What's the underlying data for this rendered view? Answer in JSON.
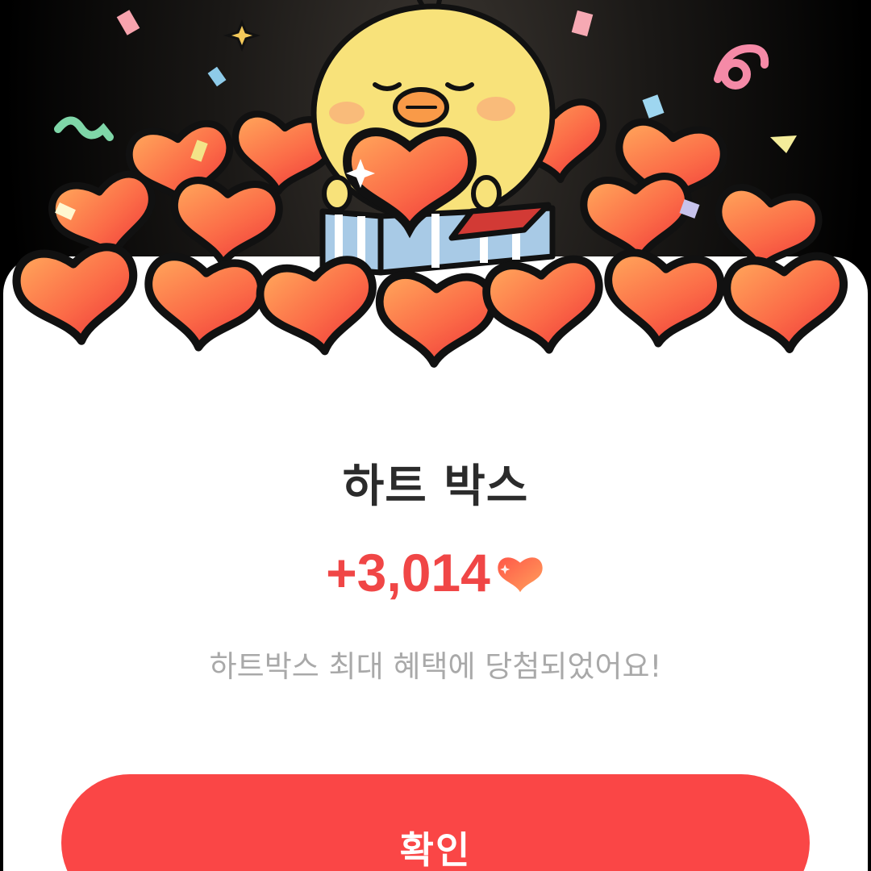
{
  "dialog": {
    "title": "하트 박스",
    "amount": "+3,014",
    "amount_icon": "heart-icon",
    "description": "하트박스 최대 혜택에 당첨되었어요!",
    "confirm_label": "확인"
  },
  "illustration": {
    "subject": "chick-holding-heart-in-gift-box",
    "items": [
      "hearts-pile",
      "confetti",
      "sparkles"
    ]
  },
  "colors": {
    "accent": "#fa4646",
    "amount_text": "#f04646",
    "title_text": "#2b2b2b",
    "description_text": "#a9a9a9",
    "heart_light": "#ff9a55",
    "heart_dark": "#f0463c",
    "chick_body": "#f8e27a",
    "background": "#000000",
    "sheet": "#ffffff"
  }
}
